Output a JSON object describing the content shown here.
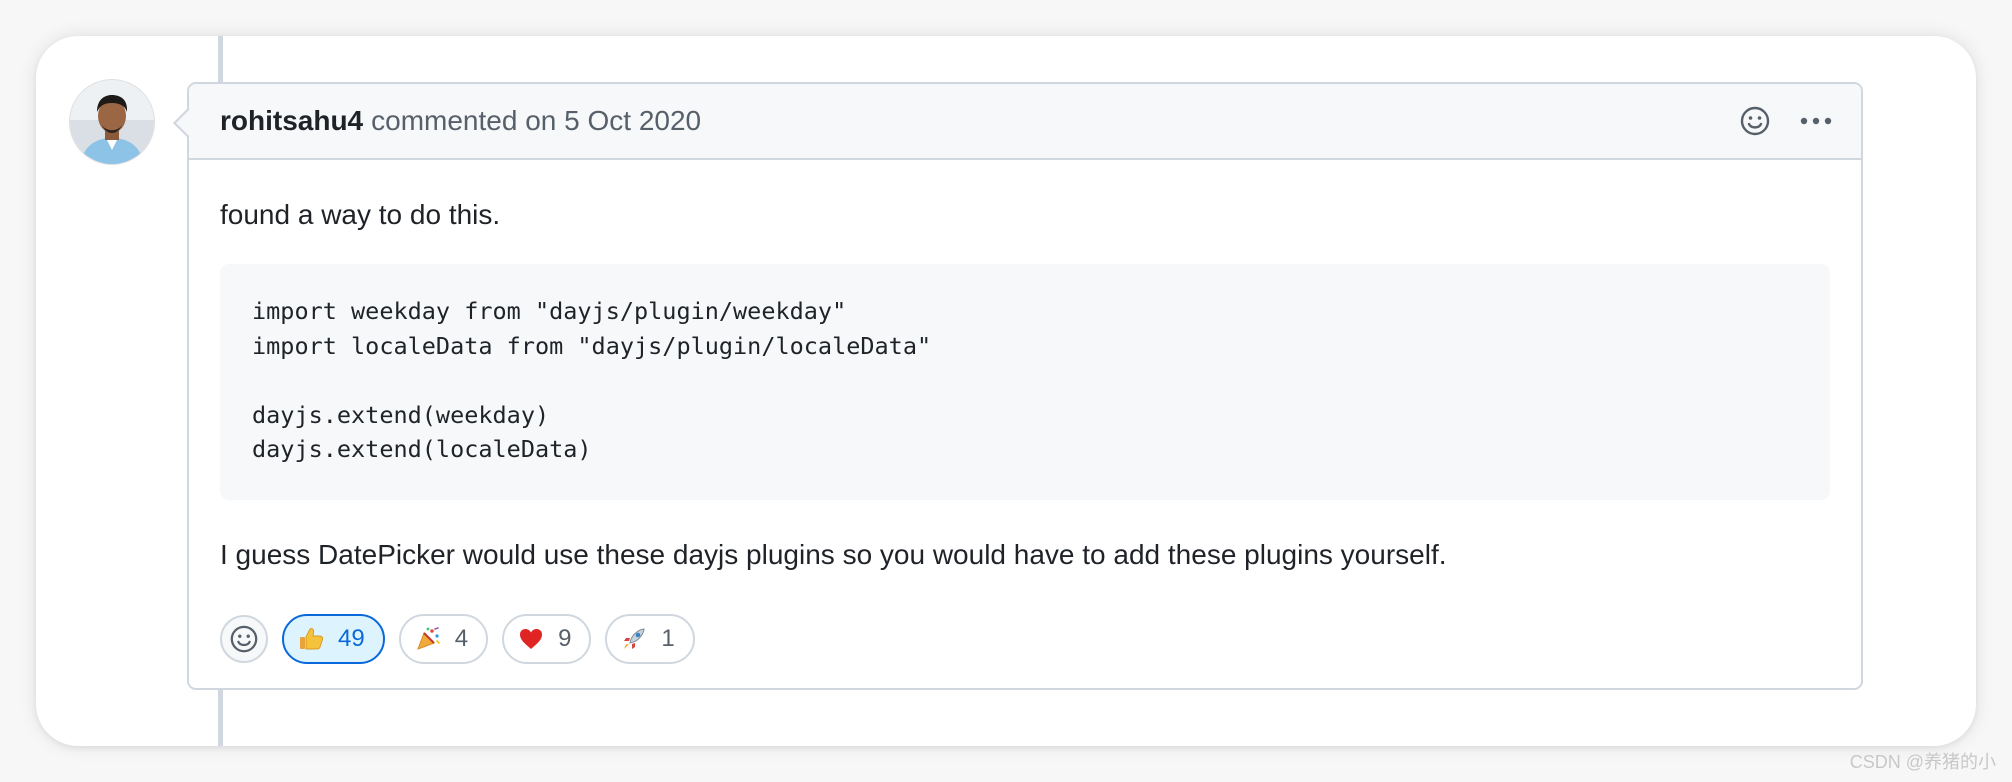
{
  "comment": {
    "author": "rohitsahu4",
    "meta": "commented on 5 Oct 2020",
    "body_intro": "found a way to do this.",
    "code_lines": [
      "import weekday from \"dayjs/plugin/weekday\"",
      "import localeData from \"dayjs/plugin/localeData\"",
      "",
      "dayjs.extend(weekday)",
      "dayjs.extend(localeData)"
    ],
    "body_outro": "I guess DatePicker would use these dayjs plugins so you would have to add these plugins yourself."
  },
  "header_actions": {
    "reaction_icon": "smiley-icon",
    "more_icon": "kebab-horizontal-icon"
  },
  "reactions": [
    {
      "icon": "thumbs-up-icon",
      "count": "49",
      "active": true
    },
    {
      "icon": "tada-icon",
      "count": "4",
      "active": false
    },
    {
      "icon": "heart-icon",
      "count": "9",
      "active": false
    },
    {
      "icon": "rocket-icon",
      "count": "1",
      "active": false
    }
  ],
  "colors": {
    "border": "#d0d7de",
    "header_bg": "#f6f8fa",
    "active_reaction_bg": "#ddf4ff",
    "active_reaction_border": "#0969da"
  },
  "watermark": "CSDN @养猪的小"
}
